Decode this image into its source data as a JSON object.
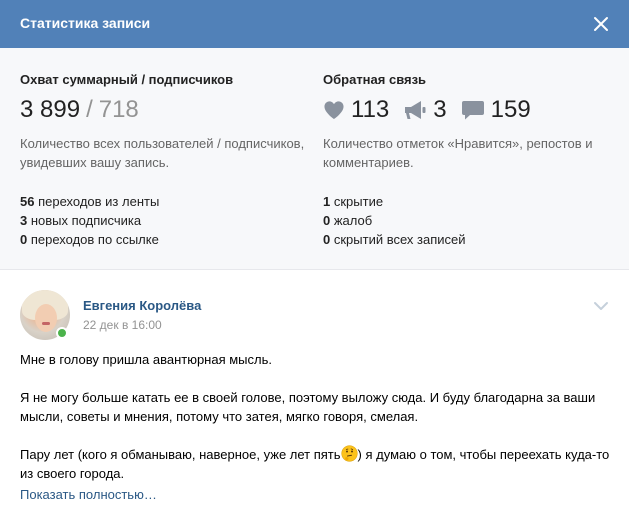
{
  "header": {
    "title": "Статистика записи"
  },
  "reach": {
    "title": "Охват суммарный / подписчиков",
    "total": "3 899",
    "separator": "/",
    "subscribers": "718",
    "description": "Количество всех пользователей / подписчиков, увидевших вашу запись.",
    "metrics": [
      {
        "count": "56",
        "label": "переходов из ленты"
      },
      {
        "count": "3",
        "label": "новых подписчика"
      },
      {
        "count": "0",
        "label": "переходов по ссылке"
      }
    ]
  },
  "feedback": {
    "title": "Обратная связь",
    "likes": "113",
    "reposts": "3",
    "comments": "159",
    "description": "Количество отметок «Нравится», репостов и комментариев.",
    "metrics": [
      {
        "count": "1",
        "label": "скрытие"
      },
      {
        "count": "0",
        "label": "жалоб"
      },
      {
        "count": "0",
        "label": "скрытий всех записей"
      }
    ]
  },
  "post": {
    "author": "Евгения Королёва",
    "date": "22 дек в 16:00",
    "paragraphs": [
      "Мне в голову пришла авантюрная мысль.",
      "Я не могу больше катать ее в своей голове, поэтому выложу сюда. И буду благодарна за ваши мысли, советы и мнения, потому что затея, мягко говоря, смелая."
    ],
    "last_before": "Пару лет (кого я обманываю, наверное, уже лет пять",
    "last_after": ") я думаю о том, чтобы переехать куда-то из своего города.",
    "show_more": "Показать полностью…"
  },
  "colors": {
    "header_bg": "#5181b8",
    "link": "#2a5885",
    "muted": "#939393",
    "online": "#4bb34b"
  },
  "icons": [
    "close-icon",
    "heart-icon",
    "megaphone-icon",
    "comment-icon",
    "chevron-down-icon",
    "thinking-emoji-icon"
  ]
}
